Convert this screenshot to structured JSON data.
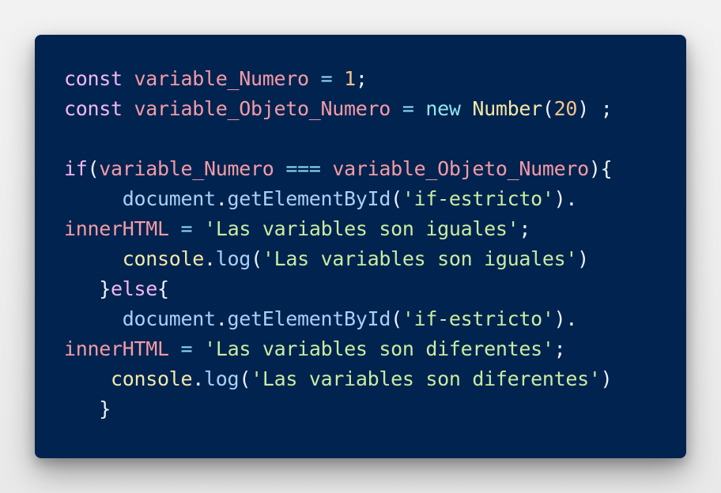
{
  "code_block": {
    "lines": [
      [
        {
          "text": "const",
          "type": "kw"
        },
        {
          "text": " ",
          "type": "punc"
        },
        {
          "text": "variable_Numero",
          "type": "var"
        },
        {
          "text": " ",
          "type": "punc"
        },
        {
          "text": "=",
          "type": "op"
        },
        {
          "text": " ",
          "type": "punc"
        },
        {
          "text": "1",
          "type": "num"
        },
        {
          "text": ";",
          "type": "punc"
        }
      ],
      [
        {
          "text": "const",
          "type": "kw"
        },
        {
          "text": " ",
          "type": "punc"
        },
        {
          "text": "variable_Objeto_Numero",
          "type": "var"
        },
        {
          "text": " ",
          "type": "punc"
        },
        {
          "text": "=",
          "type": "op"
        },
        {
          "text": " ",
          "type": "punc"
        },
        {
          "text": "new",
          "type": "new"
        },
        {
          "text": " ",
          "type": "punc"
        },
        {
          "text": "Number",
          "type": "cls"
        },
        {
          "text": "(",
          "type": "punc"
        },
        {
          "text": "20",
          "type": "num"
        },
        {
          "text": ") ;",
          "type": "punc"
        }
      ],
      [],
      [
        {
          "text": "if",
          "type": "kw"
        },
        {
          "text": "(",
          "type": "punc"
        },
        {
          "text": "variable_Numero",
          "type": "var"
        },
        {
          "text": " ",
          "type": "punc"
        },
        {
          "text": "===",
          "type": "op"
        },
        {
          "text": " ",
          "type": "punc"
        },
        {
          "text": "variable_Objeto_Numero",
          "type": "var"
        },
        {
          "text": "){",
          "type": "punc"
        }
      ],
      [
        {
          "text": "     ",
          "type": "punc"
        },
        {
          "text": "document",
          "type": "fn"
        },
        {
          "text": ".",
          "type": "punc"
        },
        {
          "text": "getElementById",
          "type": "fn"
        },
        {
          "text": "(",
          "type": "punc"
        },
        {
          "text": "'if-estricto'",
          "type": "str"
        },
        {
          "text": ").",
          "type": "punc"
        }
      ],
      [
        {
          "text": "innerHTML",
          "type": "var"
        },
        {
          "text": " ",
          "type": "punc"
        },
        {
          "text": "=",
          "type": "op"
        },
        {
          "text": " ",
          "type": "punc"
        },
        {
          "text": "'Las variables son iguales'",
          "type": "str"
        },
        {
          "text": ";",
          "type": "punc"
        }
      ],
      [
        {
          "text": "     ",
          "type": "punc"
        },
        {
          "text": "console",
          "type": "obj"
        },
        {
          "text": ".",
          "type": "punc"
        },
        {
          "text": "log",
          "type": "fn"
        },
        {
          "text": "(",
          "type": "punc"
        },
        {
          "text": "'Las variables son iguales'",
          "type": "str"
        },
        {
          "text": ")",
          "type": "punc"
        }
      ],
      [
        {
          "text": "   ",
          "type": "punc"
        },
        {
          "text": "}",
          "type": "punc"
        },
        {
          "text": "else",
          "type": "kw"
        },
        {
          "text": "{",
          "type": "punc"
        }
      ],
      [
        {
          "text": "     ",
          "type": "punc"
        },
        {
          "text": "document",
          "type": "fn"
        },
        {
          "text": ".",
          "type": "punc"
        },
        {
          "text": "getElementById",
          "type": "fn"
        },
        {
          "text": "(",
          "type": "punc"
        },
        {
          "text": "'if-estricto'",
          "type": "str"
        },
        {
          "text": ").",
          "type": "punc"
        }
      ],
      [
        {
          "text": "innerHTML",
          "type": "var"
        },
        {
          "text": " ",
          "type": "punc"
        },
        {
          "text": "=",
          "type": "op"
        },
        {
          "text": " ",
          "type": "punc"
        },
        {
          "text": "'Las variables son diferentes'",
          "type": "str"
        },
        {
          "text": ";",
          "type": "punc"
        }
      ],
      [
        {
          "text": "    ",
          "type": "punc"
        },
        {
          "text": "console",
          "type": "obj"
        },
        {
          "text": ".",
          "type": "punc"
        },
        {
          "text": "log",
          "type": "fn"
        },
        {
          "text": "(",
          "type": "punc"
        },
        {
          "text": "'Las variables son diferentes'",
          "type": "str"
        },
        {
          "text": ")",
          "type": "punc"
        }
      ],
      [
        {
          "text": "   ",
          "type": "punc"
        },
        {
          "text": "}",
          "type": "punc"
        }
      ]
    ]
  },
  "colors": {
    "background": "#012350",
    "keyword": "#f2b8ef",
    "variable": "#f49ba4",
    "operator": "#8fd6ef",
    "number": "#f6c38a",
    "string": "#c9ec9f",
    "function": "#a9d1f7",
    "class": "#f4e9a6"
  }
}
